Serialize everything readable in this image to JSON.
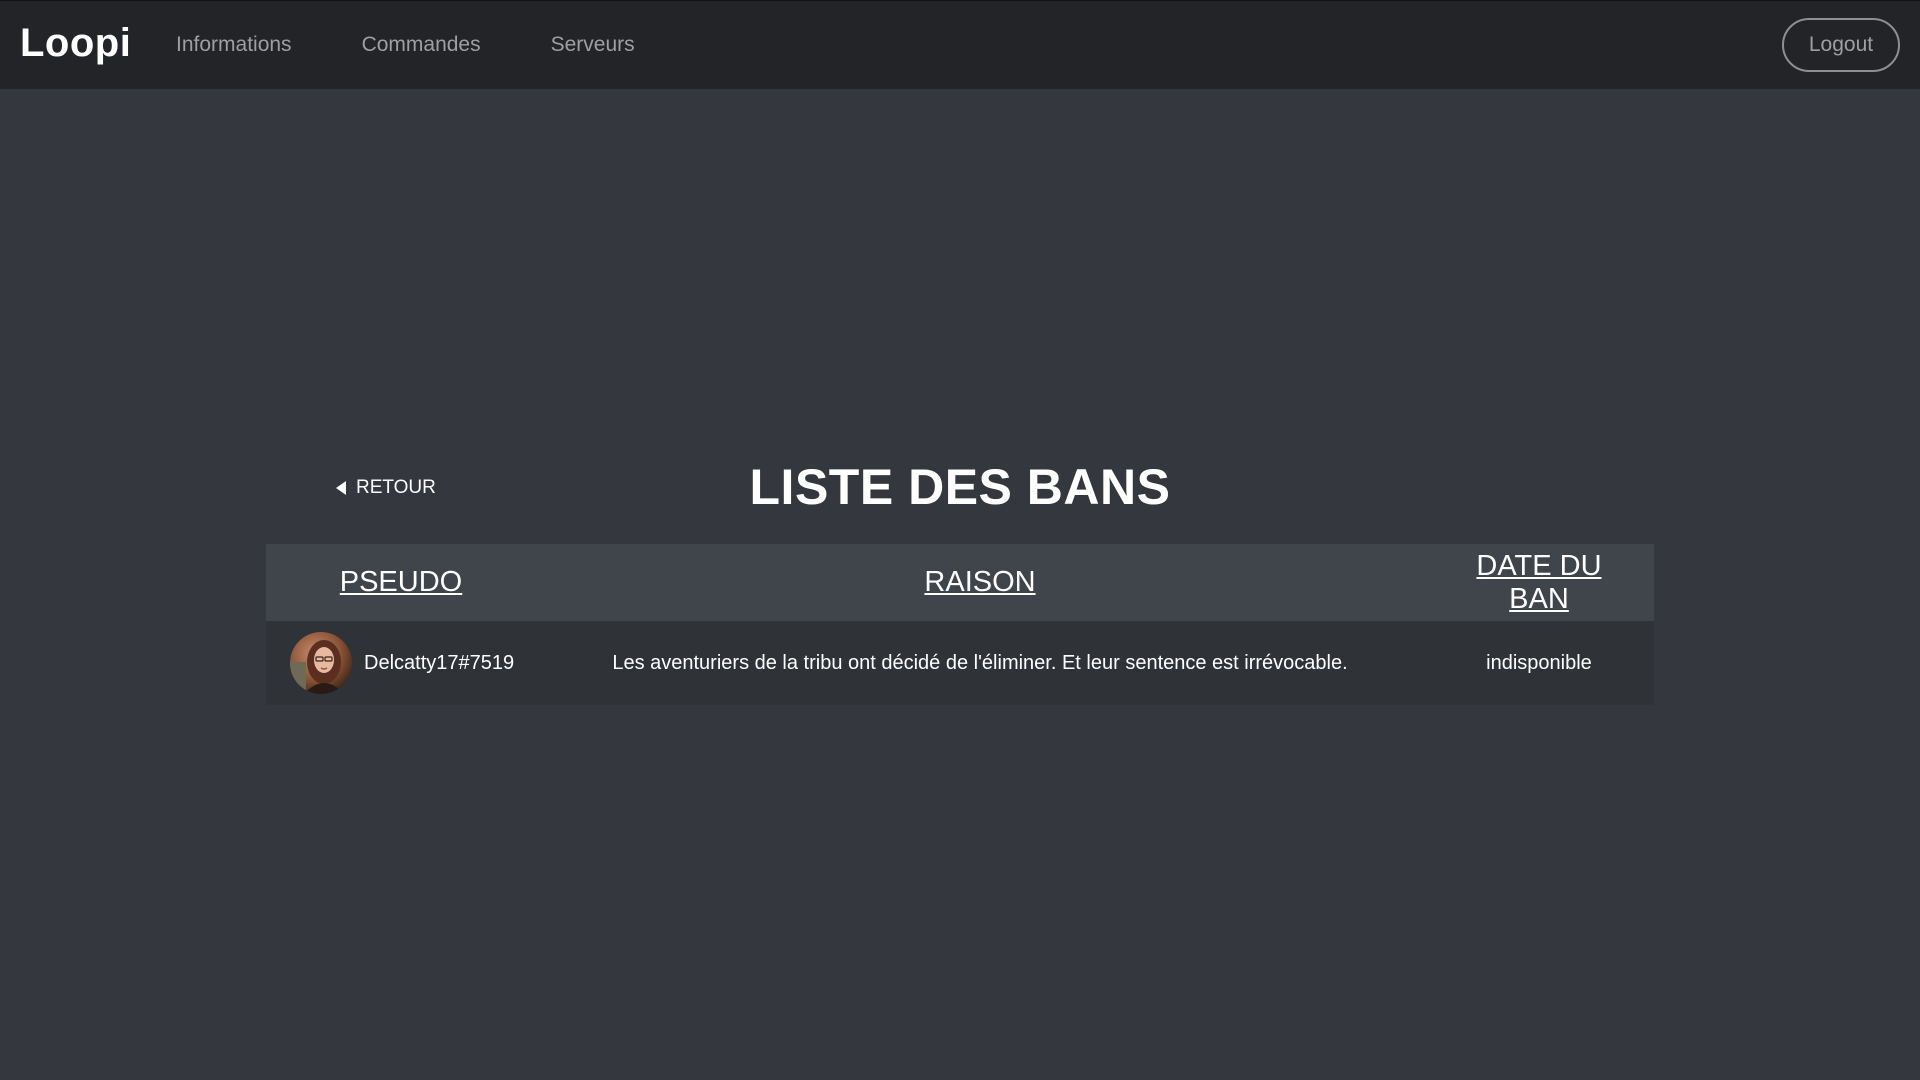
{
  "navbar": {
    "brand": "Loopi",
    "links": [
      {
        "label": "Informations"
      },
      {
        "label": "Commandes"
      },
      {
        "label": "Serveurs"
      }
    ],
    "logout_label": "Logout"
  },
  "page": {
    "back_label": "RETOUR",
    "title": "LISTE DES BANS"
  },
  "table": {
    "headers": {
      "pseudo": "PSEUDO",
      "raison": "RAISON",
      "date": "DATE DU BAN"
    },
    "rows": [
      {
        "pseudo": "Delcatty17#7519",
        "raison": "Les aventuriers de la tribu ont décidé de l'éliminer. Et leur sentence est irrévocable.",
        "date": "indisponible"
      }
    ]
  },
  "colors": {
    "background": "#34373d",
    "navbar": "#222428",
    "table_header": "#40444b",
    "table_row": "#2f3237"
  }
}
